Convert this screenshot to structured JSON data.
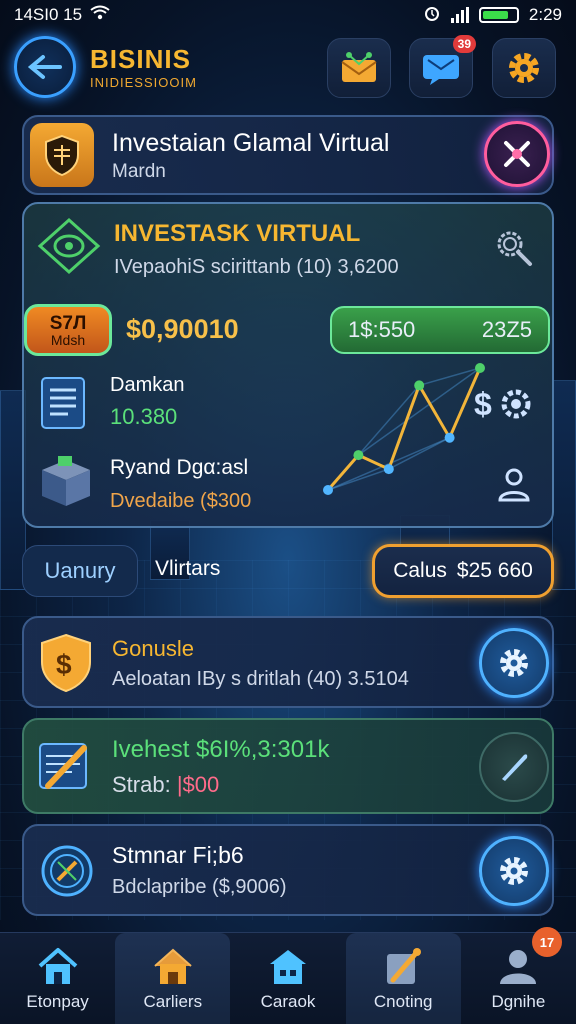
{
  "status_bar": {
    "time_left": "14SI0 15",
    "time_right": "2:29"
  },
  "header": {
    "brand_title": "BISINIS",
    "brand_subtitle": "INIDIESSIOOIM",
    "mail_badge": "39"
  },
  "hero": {
    "title": "Investaian Glamal Virtual",
    "subtitle": "Mardn"
  },
  "invest_card": {
    "title": "INVESTASK VIRTUAL",
    "subtitle": "IVepaohiS  scirittanb (10) 3,6200",
    "chip_line1": "S7Л",
    "chip_line2": "Mdsh",
    "amount": "$0,90010",
    "green_left": "1$:550",
    "green_right": "23Z5",
    "row1_title": "Damkan",
    "row1_value": "10.380",
    "row2_title": "Ryand Dgα:asl",
    "row2_value": "Dvedaibe ($300",
    "chart": {
      "type": "line",
      "x": [
        1,
        2,
        3,
        4,
        5,
        6
      ],
      "y": [
        3,
        5,
        4.2,
        9,
        6,
        10
      ]
    }
  },
  "tabs": {
    "tab1": "Uanury",
    "tab2": "Vlirtars",
    "calc_label": "Calus",
    "calc_value": "$25 660"
  },
  "list": [
    {
      "title": "Gonusle",
      "subtitle": "Aeloatan IBy s dritlah (40) 3.5104"
    },
    {
      "title": "Ivehest  $6I%,3:301k",
      "subtitle_a": "Strab: ",
      "subtitle_b": "|$00"
    },
    {
      "title": "Stmnar Fi;b6",
      "subtitle": "Bdclapribe ($,9006)"
    }
  ],
  "nav": [
    {
      "label": "Etonpay"
    },
    {
      "label": "Carliers"
    },
    {
      "label": "Caraok"
    },
    {
      "label": "Cnoting"
    },
    {
      "label": "Dgnihe",
      "badge": "17"
    }
  ],
  "colors": {
    "accent_blue": "#3aa0ff",
    "gold": "#f7b731",
    "green": "#4ed06a"
  }
}
